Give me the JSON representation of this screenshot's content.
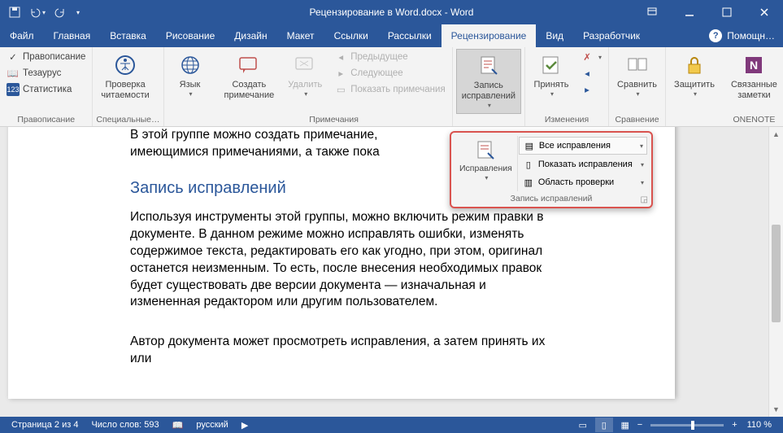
{
  "title": "Рецензирование в Word.docx - Word",
  "menubar": {
    "tabs": [
      "Файл",
      "Главная",
      "Вставка",
      "Рисование",
      "Дизайн",
      "Макет",
      "Ссылки",
      "Рассылки",
      "Рецензирование",
      "Вид",
      "Разработчик"
    ],
    "active_index": 8,
    "help": "Помощн…"
  },
  "ribbon": {
    "groups": {
      "proofing": {
        "label": "Правописание",
        "spelling": "Правописание",
        "thesaurus": "Тезаурус",
        "statistics": "Статистика"
      },
      "accessibility": {
        "label": "Специальные…",
        "readability": "Проверка\nчитаемости"
      },
      "language": {
        "btn": "Язык"
      },
      "comments": {
        "label": "Примечания",
        "create": "Создать\nпримечание",
        "delete": "Удалить",
        "prev": "Предыдущее",
        "next": "Следующее",
        "show": "Показать примечания"
      },
      "tracking": {
        "label": "Запись\nисправлений"
      },
      "changes": {
        "label": "Изменения",
        "accept": "Принять"
      },
      "compare": {
        "label": "Сравнение",
        "compare": "Сравнить"
      },
      "protect": {
        "btn": "Защитить"
      },
      "onenote": {
        "label": "ONENOTE",
        "btn": "Связанные\nзаметки"
      }
    }
  },
  "callout": {
    "big": "Исправления",
    "all": "Все исправления",
    "show": "Показать исправления",
    "review_area": "Область проверки",
    "footer": "Запись исправлений"
  },
  "document": {
    "p1": "В этой группе можно создать примечание,",
    "p2": "имеющимися примечаниями, а также пока",
    "heading": "Запись исправлений",
    "body": "Используя инструменты этой группы, можно включить режим правки в документе. В данном режиме можно исправлять ошибки, изменять содержимое текста, редактировать его как угодно, при этом, оригинал останется неизменным. То есть, после внесения необходимых правок будет существовать две версии документа — изначальная и измененная редактором или другим пользователем.",
    "p3": "Автор документа может просмотреть исправления, а затем принять их или"
  },
  "statusbar": {
    "page": "Страница 2 из 4",
    "words": "Число слов: 593",
    "lang": "русский",
    "zoom": "110 %"
  }
}
